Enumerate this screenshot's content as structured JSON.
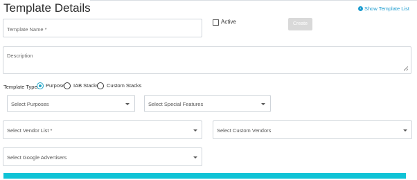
{
  "header": {
    "title": "Template Details",
    "show_link_label": "Show Template List",
    "show_link_icon": "chevron-left-circle-icon"
  },
  "form": {
    "template_name": {
      "placeholder": "Template Name *",
      "value": ""
    },
    "active": {
      "label": "Active",
      "checked": false
    },
    "create_button": "Create",
    "description": {
      "placeholder": "Description",
      "value": ""
    },
    "template_type": {
      "label": "Template Type:",
      "options": [
        "Purpose",
        "IAB Stacks",
        "Custom Stacks"
      ],
      "selected": "Purpose"
    },
    "purposes": {
      "placeholder": "Select Purposes"
    },
    "special_features": {
      "placeholder": "Select Special Features"
    },
    "vendor_list": {
      "placeholder": "Select Vendor List *"
    },
    "custom_vendors": {
      "placeholder": "Select Custom Vendors"
    },
    "google_advertisers": {
      "placeholder": "Select Google Advertisers"
    }
  },
  "colors": {
    "accent": "#1a9bcf",
    "radio_selected": "#1fa3c6",
    "bottom_bar": "#10c3d6",
    "disabled_button": "#d9d9d9"
  }
}
